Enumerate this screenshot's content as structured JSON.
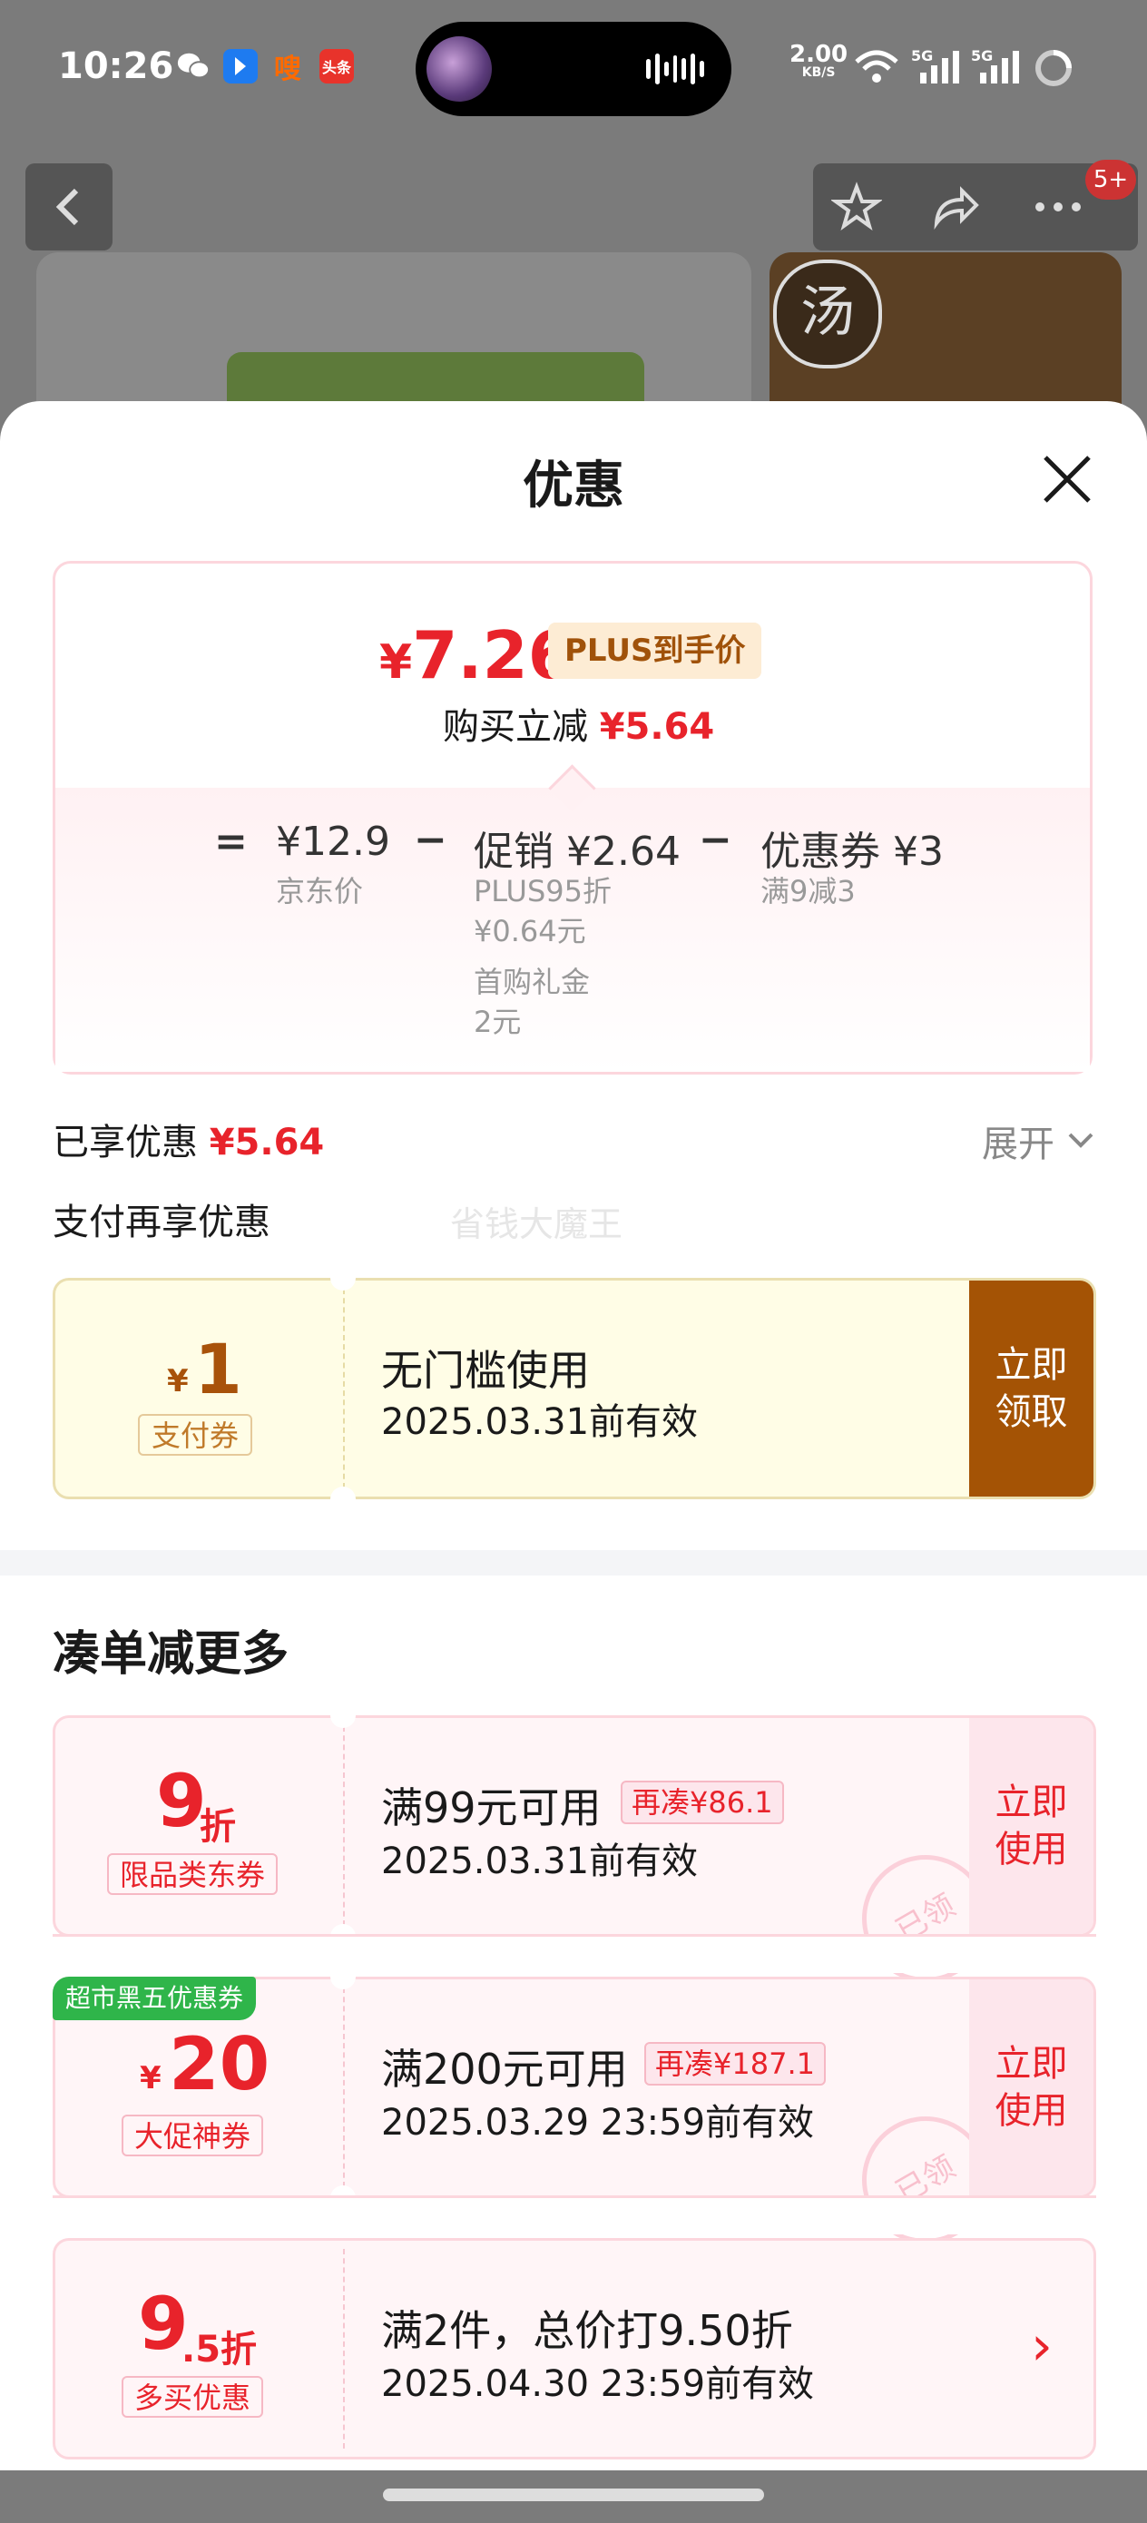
{
  "status_bar": {
    "time": "10:26",
    "net_speed": "2.00",
    "net_unit": "KB/S",
    "sig1": "5G",
    "sig2": "5G",
    "app_tag": "头条",
    "app_tag2": "嗖"
  },
  "background": {
    "badge": "5+",
    "logo_char": "汤"
  },
  "sheet": {
    "title": "优惠"
  },
  "price": {
    "currency": "¥",
    "final": "7.26",
    "plus_label": "PLUS到手价",
    "buy_less_label": "购买立减",
    "buy_less_amount": "¥5.64"
  },
  "breakdown": {
    "eq": "=",
    "minus": "−",
    "jd_price": "¥12.9",
    "jd_label": "京东价",
    "promo_label": "促销",
    "promo_amount": "¥2.64",
    "promo_sub1": "PLUS95折",
    "promo_sub2": "¥0.64元",
    "promo_sub3": "首购礼金",
    "promo_sub4": "2元",
    "coupon_label": "优惠券",
    "coupon_amount": "¥3",
    "coupon_sub": "满9减3"
  },
  "enjoyed": {
    "label": "已享优惠",
    "amount": "¥5.64",
    "expand": "展开"
  },
  "pay_more": {
    "label": "支付再享优惠",
    "watermark": "省钱大魔王"
  },
  "pay_coupon": {
    "yen": "¥",
    "amount": "1",
    "tag": "支付券",
    "title": "无门槛使用",
    "date": "2025.03.31前有效",
    "btn_line1": "立即",
    "btn_line2": "领取"
  },
  "section_title": "凑单减更多",
  "coupons": [
    {
      "big": "9",
      "small": "折",
      "tag": "限品类东券",
      "title": "满99元可用",
      "again": "再凑¥86.1",
      "date": "2025.03.31前有效",
      "btn_line1": "立即",
      "btn_line2": "使用",
      "stamp": "已领"
    },
    {
      "badge": "超市黑五优惠券",
      "yen": "¥",
      "big": "20",
      "tag": "大促神券",
      "title": "满200元可用",
      "again": "再凑¥187.1",
      "date": "2025.03.29 23:59前有效",
      "btn_line1": "立即",
      "btn_line2": "使用",
      "stamp": "已领"
    },
    {
      "big": "9",
      "small": ".5折",
      "tag": "多买优惠",
      "title": "满2件，总价打9.50折",
      "date": "2025.04.30 23:59前有效",
      "arrow": "›"
    }
  ],
  "colors": {
    "accent_red": "#e8232b",
    "gold": "#a45305",
    "plus_tag_bg": "#fdecd4",
    "green_badge": "#2fb54a"
  }
}
